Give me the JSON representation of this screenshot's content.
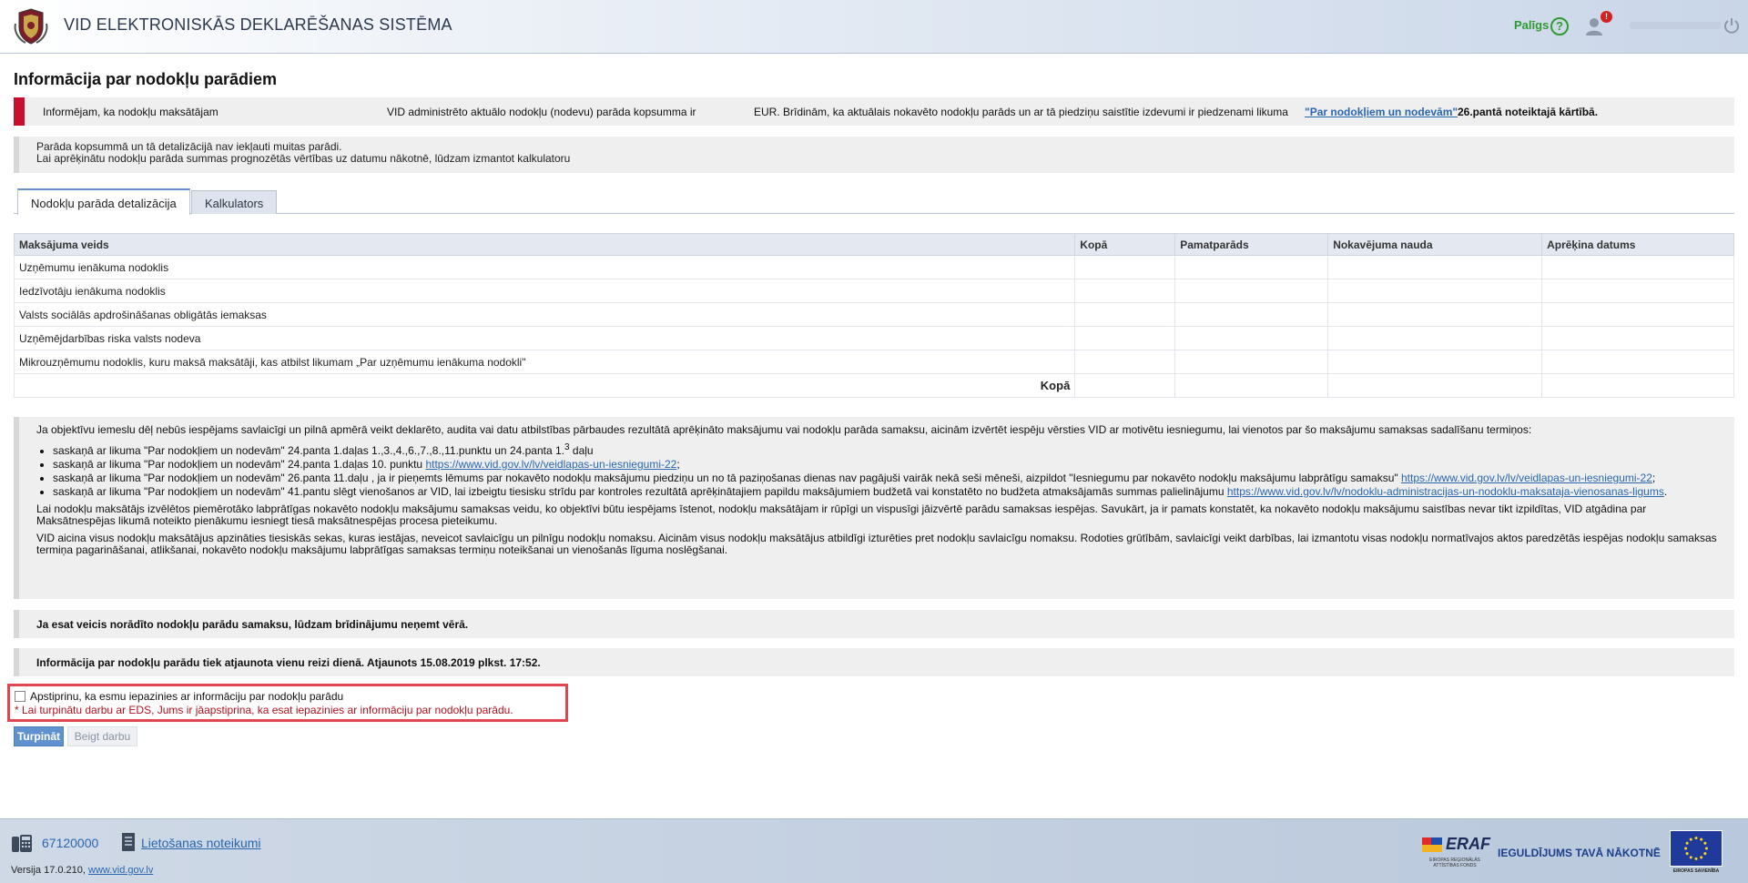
{
  "header": {
    "app_title": "VID ELEKTRONISKĀS DEKLARĒŠANAS SISTĒMA",
    "help_label": "Palīgs",
    "help_icon": "question-circle-icon",
    "notification_count": "!",
    "accent_green": "#2f9a2f"
  },
  "page": {
    "title": "Informācija par nodokļu parādiem"
  },
  "notice_red": {
    "part1": "Informējam, ka nodokļu maksātājam",
    "part2": "VID administrēto aktuālo nodokļu (nodevu) parāda kopsumma ir",
    "part3": "EUR. Brīdinām, ka aktuālais nokavēto nodokļu parāds un ar tā piedziņu saistītie izdevumi ir piedzenami likuma",
    "link": "\"Par nodokļiem un nodevām\"",
    "part4": "26.pantā noteiktajā kārtībā."
  },
  "notice_gray": {
    "line1": "Parāda kopsummā un tā detalizācijā nav iekļauti muitas parādi.",
    "line2": "Lai aprēķinātu nodokļu parāda summas prognozētās vērtības uz datumu nākotnē, lūdzam izmantot kalkulatoru"
  },
  "tabs": [
    {
      "label": "Nodokļu parāda detalizācija",
      "active": true
    },
    {
      "label": "Kalkulators",
      "active": false
    }
  ],
  "table": {
    "columns": [
      "Maksājuma veids",
      "Kopā",
      "Pamatparāds",
      "Nokavējuma nauda",
      "Aprēķina datums"
    ],
    "rows": [
      [
        "Uzņēmumu ienākuma nodoklis",
        "",
        "",
        "",
        ""
      ],
      [
        "Iedzīvotāju ienākuma nodoklis",
        "",
        "",
        "",
        ""
      ],
      [
        "Valsts sociālās apdrošināšanas obligātās iemaksas",
        "",
        "",
        "",
        ""
      ],
      [
        "Uzņēmējdarbības riska valsts nodeva",
        "",
        "",
        "",
        ""
      ],
      [
        "Mikrouzņēmumu nodoklis, kuru maksā maksātāji, kas atbilst likumam „Par uzņēmumu ienākuma nodokli\"",
        "",
        "",
        "",
        ""
      ]
    ],
    "total_label": "Kopā"
  },
  "info": {
    "intro": "Ja objektīvu iemeslu dēļ nebūs iespējams savlaicīgi un pilnā apmērā veikt deklarēto, audita vai datu atbilstības pārbaudes rezultātā aprēķināto maksājumu vai nodokļu parāda samaksu, aicinām izvērtēt iespēju vērsties VID ar motivētu iesniegumu, lai vienotos par šo maksājumu samaksas sadalīšanu termiņos:",
    "item1": "saskaņā ar likuma \"Par nodokļiem un nodevām\" 24.panta 1.daļas 1.,3.,4.,6.,7.,8.,11.punktu un 24.panta 1.",
    "item1_sup": "3",
    "item1_end": " daļu",
    "item2": "saskaņā ar likuma \"Par nodokļiem un nodevām\" 24.panta 1.daļas 10. punktu ",
    "item2_link": "https://www.vid.gov.lv/lv/veidlapas-un-iesniegumi-22",
    "item2_end": ";",
    "item3": "saskaņā ar likuma \"Par nodokļiem un nodevām\" 26.panta 11.daļu , ja ir pieņemts lēmums par nokavēto nodokļu maksājumu piedziņu un no tā paziņošanas dienas nav pagājuši vairāk nekā seši mēneši, aizpildot \"Iesniegumu par nokavēto nodokļu maksājumu labprātīgu samaksu\" ",
    "item3_link": "https://www.vid.gov.lv/lv/veidlapas-un-iesniegumi-22",
    "item3_end": ";",
    "item4": "saskaņā ar likuma \"Par nodokļiem un nodevām\" 41.pantu slēgt vienošanos ar VID, lai izbeigtu tiesisku strīdu par kontroles rezultātā aprēķinātajiem papildu maksājumiem budžetā vai konstatēto no budžeta atmaksājamās summas palielinājumu ",
    "item4_link": "https://www.vid.gov.lv/lv/nodoklu-administracijas-un-nodoklu-maksataja-vienosanas-ligums",
    "item4_end": ".",
    "para1": "Lai nodokļu maksātājs izvēlētos piemērotāko labprātīgas nokavēto nodokļu maksājumu samaksas veidu, ko objektīvi būtu iespējams īstenot, nodokļu maksātājam ir rūpīgi un vispusīgi jāizvērtē parādu samaksas iespējas. Savukārt, ja ir pamats konstatēt, ka nokavēto nodokļu maksājumu saistības nevar tikt izpildītas, VID atgādina par Maksātnespējas likumā noteikto pienākumu iesniegt tiesā maksātnespējas procesa pieteikumu.",
    "para2": "VID aicina visus nodokļu maksātājus apzināties tiesiskās sekas, kuras iestājas, neveicot savlaicīgu un pilnīgu nodokļu nomaksu. Aicinām visus nodokļu maksātājus atbildīgi izturēties pret nodokļu savlaicīgu nomaksu. Rodoties grūtībām, savlaicīgi veikt darbības, lai izmantotu visas nodokļu normatīvajos aktos paredzētās iespējas nodokļu samaksas termiņa pagarināšanai, atlikšanai, nokavēto nodokļu maksājumu labprātīgas samaksas termiņu noteikšanai un vienošanās līguma noslēgšanai."
  },
  "notice_paid": "Ja esat veicis norādīto nodokļu parādu samaksu, lūdzam brīdinājumu neņemt vērā.",
  "notice_update": "Informācija par nodokļu parādu tiek atjaunota vienu reizi dienā. Atjaunots 15.08.2019 plkst. 17:52.",
  "confirm": {
    "label": "Apstiprinu, ka esmu iepazinies ar informāciju par nodokļu parādu",
    "error": "* Lai turpinātu darbu ar EDS, Jums ir jāapstiprina, ka esat iepazinies ar informāciju par nodokļu parādu.",
    "error_color": "#b3121e"
  },
  "buttons": {
    "continue": "Turpināt",
    "finish": "Beigt darbu"
  },
  "footer": {
    "phone": "67120000",
    "terms": "Lietošanas noteikumi",
    "version_prefix": "Versija 17.0.210, ",
    "version_link": "www.vid.gov.lv",
    "eraf_logo_text": "ERAF",
    "eraf_sub": "EIROPAS REĢIONĀLĀS ATTĪSTĪBAS FONDS",
    "slogan": "IEGULDĪJUMS TAVĀ NĀKOTNĒ",
    "eu_caption": "EIROPAS SAVIENĪBA"
  }
}
